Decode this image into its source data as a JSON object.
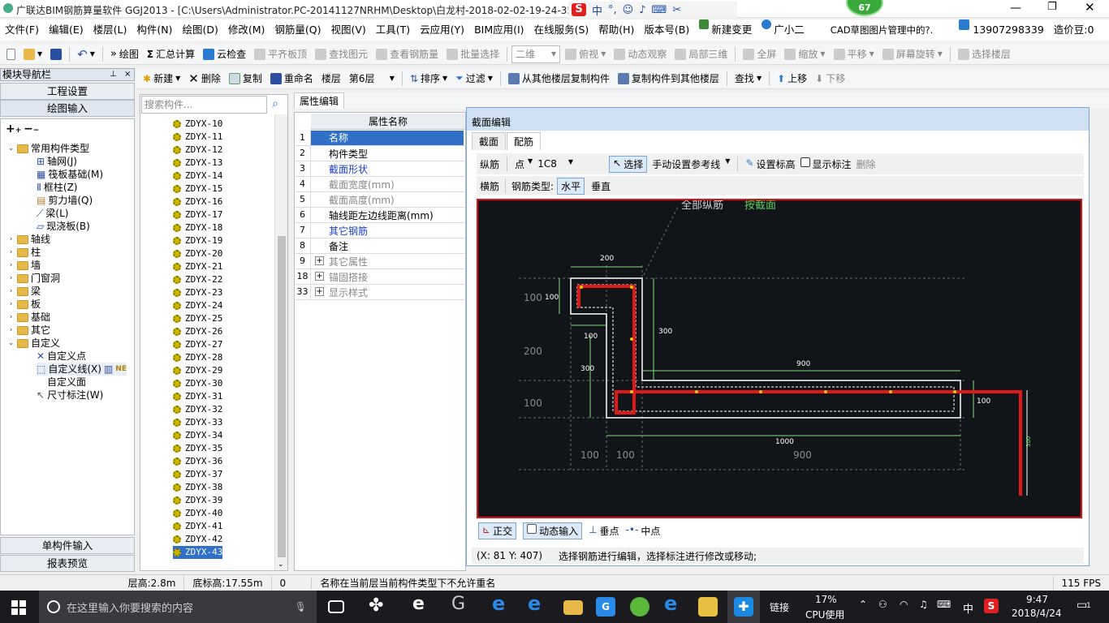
{
  "window": {
    "title": "广联达BIM钢筋算量软件 GGJ2013 - [C:\\Users\\Administrator.PC-20141127NRHM\\Desktop\\白龙村-2018-02-02-19-24-35",
    "badge": "67"
  },
  "menu": [
    "文件(F)",
    "编辑(E)",
    "楼层(L)",
    "构件(N)",
    "绘图(D)",
    "修改(M)",
    "钢筋量(Q)",
    "视图(V)",
    "工具(T)",
    "云应用(Y)",
    "BIM应用(I)",
    "在线服务(S)",
    "帮助(H)",
    "版本号(B)",
    "新建变更",
    "广小二",
    "CAD草图图片管理中的?.",
    "13907298339",
    "造价豆:0"
  ],
  "toolbar1": {
    "items": [
      "绘图",
      "汇总计算",
      "云检查",
      "平齐板顶",
      "查找图元",
      "查看钢筋量",
      "批量选择",
      "二维",
      "俯视",
      "动态观察",
      "局部三维",
      "全屏",
      "缩放",
      "平移",
      "屏幕旋转",
      "选择楼层"
    ]
  },
  "toolbar2": {
    "items": [
      "新建",
      "删除",
      "复制",
      "重命名",
      "楼层",
      "第6层",
      "排序",
      "过滤",
      "从其他楼层复制构件",
      "复制构件到其他楼层",
      "查找",
      "上移",
      "下移"
    ]
  },
  "nav": {
    "header": "模块导航栏",
    "top_buttons": [
      "工程设置",
      "绘图输入"
    ],
    "tree": [
      {
        "label": "常用构件类型",
        "level": 0,
        "expanded": true,
        "folder": true
      },
      {
        "label": "轴网(J)",
        "level": 1
      },
      {
        "label": "筏板基础(M)",
        "level": 1
      },
      {
        "label": "框柱(Z)",
        "level": 1
      },
      {
        "label": "剪力墙(Q)",
        "level": 1
      },
      {
        "label": "梁(L)",
        "level": 1
      },
      {
        "label": "现浇板(B)",
        "level": 1
      },
      {
        "label": "轴线",
        "level": 0,
        "folder": true
      },
      {
        "label": "柱",
        "level": 0,
        "folder": true
      },
      {
        "label": "墙",
        "level": 0,
        "folder": true
      },
      {
        "label": "门窗洞",
        "level": 0,
        "folder": true
      },
      {
        "label": "梁",
        "level": 0,
        "folder": true
      },
      {
        "label": "板",
        "level": 0,
        "folder": true
      },
      {
        "label": "基础",
        "level": 0,
        "folder": true
      },
      {
        "label": "其它",
        "level": 0,
        "folder": true
      },
      {
        "label": "自定义",
        "level": 0,
        "expanded": true,
        "folder": true
      },
      {
        "label": "自定义点",
        "level": 1
      },
      {
        "label": "自定义线(X)",
        "level": 1,
        "new": "NE"
      },
      {
        "label": "自定义面",
        "level": 1
      },
      {
        "label": "尺寸标注(W)",
        "level": 1
      }
    ],
    "bottom_buttons": [
      "单构件输入",
      "报表预览"
    ]
  },
  "components": {
    "search_placeholder": "搜索构件...",
    "items": [
      "ZDYX-10",
      "ZDYX-11",
      "ZDYX-12",
      "ZDYX-13",
      "ZDYX-14",
      "ZDYX-15",
      "ZDYX-16",
      "ZDYX-17",
      "ZDYX-18",
      "ZDYX-19",
      "ZDYX-20",
      "ZDYX-21",
      "ZDYX-22",
      "ZDYX-23",
      "ZDYX-24",
      "ZDYX-25",
      "ZDYX-26",
      "ZDYX-27",
      "ZDYX-28",
      "ZDYX-29",
      "ZDYX-30",
      "ZDYX-31",
      "ZDYX-32",
      "ZDYX-33",
      "ZDYX-34",
      "ZDYX-35",
      "ZDYX-36",
      "ZDYX-37",
      "ZDYX-38",
      "ZDYX-39",
      "ZDYX-40",
      "ZDYX-41",
      "ZDYX-42",
      "ZDYX-43"
    ],
    "selected": "ZDYX-43"
  },
  "props": {
    "tab": "属性编辑",
    "header": "属性名称",
    "rows": [
      {
        "n": "1",
        "label": "名称",
        "style": "selected"
      },
      {
        "n": "2",
        "label": "构件类型",
        "style": "normal"
      },
      {
        "n": "3",
        "label": "截面形状",
        "style": "blue"
      },
      {
        "n": "4",
        "label": "截面宽度(mm)",
        "style": "gray"
      },
      {
        "n": "5",
        "label": "截面高度(mm)",
        "style": "gray"
      },
      {
        "n": "6",
        "label": "轴线距左边线距离(mm)",
        "style": "normal"
      },
      {
        "n": "7",
        "label": "其它钢筋",
        "style": "blue"
      },
      {
        "n": "8",
        "label": "备注",
        "style": "normal"
      },
      {
        "n": "9",
        "label": "其它属性",
        "style": "gray",
        "expand": true
      },
      {
        "n": "18",
        "label": "锚固搭接",
        "style": "gray",
        "expand": true
      },
      {
        "n": "33",
        "label": "显示样式",
        "style": "gray",
        "expand": true
      }
    ]
  },
  "dialog": {
    "title": "截面编辑",
    "tabs": [
      "截面",
      "配筋"
    ],
    "tool1": {
      "zongjin": "纵筋",
      "point": "点",
      "spec": "1C8",
      "select": "选择",
      "manual": "手动设置参考线",
      "set_height": "设置标高",
      "show_label": "显示标注",
      "delete": "删除"
    },
    "tool2": {
      "hengjin": "横筋",
      "type_label": "钢筋类型:",
      "horizontal": "水平",
      "vertical": "垂直"
    },
    "canvas": {
      "note": "全部纵筋",
      "note_green": "按截面",
      "dims": [
        "200",
        "100",
        "100",
        "300",
        "300",
        "900",
        "100",
        "1000",
        "200",
        "100",
        "100",
        "100",
        "900",
        "300"
      ]
    },
    "tool3": [
      "正交",
      "动态输入",
      "垂点",
      "中点"
    ],
    "status": {
      "coords": "(X: 81 Y: 407)",
      "hint": "选择钢筋进行编辑，选择标注进行修改或移动;"
    }
  },
  "statusbar": {
    "floor_height": "层高:2.8m",
    "base_height": "底标高:17.55m",
    "zero": "0",
    "message": "名称在当前层当前构件类型下不允许重名",
    "fps": "115 FPS"
  },
  "taskbar": {
    "search": "在这里输入你要搜索的内容",
    "network": "链接",
    "cpu_pct": "17%",
    "cpu_label": "CPU使用",
    "ime": "中",
    "time": "9:47",
    "date": "2018/4/24",
    "notif": "1"
  },
  "colors": {
    "accent": "#0078d7",
    "rebar": "#e01818",
    "dim": "#7ee07e",
    "canvas_bg": "#111418"
  }
}
